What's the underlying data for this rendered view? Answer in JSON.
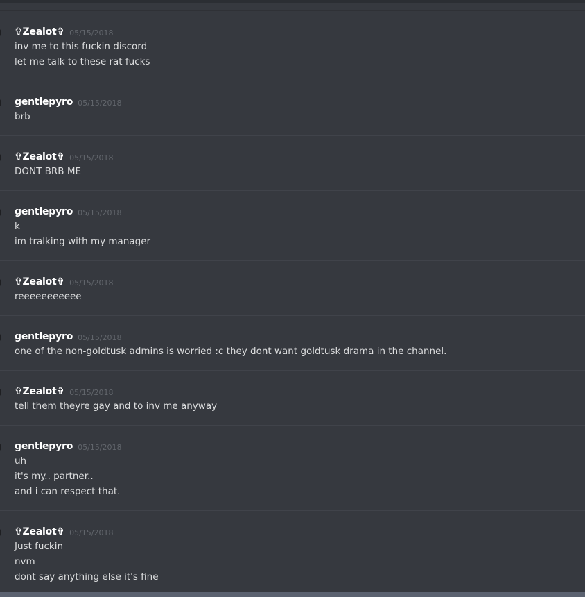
{
  "messages": [
    {
      "author": "✞Zealot✞",
      "timestamp": "05/15/2018",
      "lines": [
        "inv me to this fuckin discord",
        "let me talk to these rat fucks"
      ]
    },
    {
      "author": "gentlepyro",
      "timestamp": "05/15/2018",
      "lines": [
        "brb"
      ]
    },
    {
      "author": "✞Zealot✞",
      "timestamp": "05/15/2018",
      "lines": [
        "DONT BRB ME"
      ]
    },
    {
      "author": "gentlepyro",
      "timestamp": "05/15/2018",
      "lines": [
        "k",
        "im tralking with my manager"
      ]
    },
    {
      "author": "✞Zealot✞",
      "timestamp": "05/15/2018",
      "lines": [
        "reeeeeeeeeee"
      ]
    },
    {
      "author": "gentlepyro",
      "timestamp": "05/15/2018",
      "lines": [
        "one of the non-goldtusk admins is worried :c they dont want goldtusk drama in the channel."
      ]
    },
    {
      "author": "✞Zealot✞",
      "timestamp": "05/15/2018",
      "lines": [
        "tell them theyre gay and to inv me anyway"
      ]
    },
    {
      "author": "gentlepyro",
      "timestamp": "05/15/2018",
      "lines": [
        "uh",
        "it's my.. partner..",
        "and i can respect that."
      ]
    },
    {
      "author": "✞Zealot✞",
      "timestamp": "05/15/2018",
      "lines": [
        "Just fuckin",
        "nvm",
        "dont say anything else it's fine"
      ]
    }
  ]
}
